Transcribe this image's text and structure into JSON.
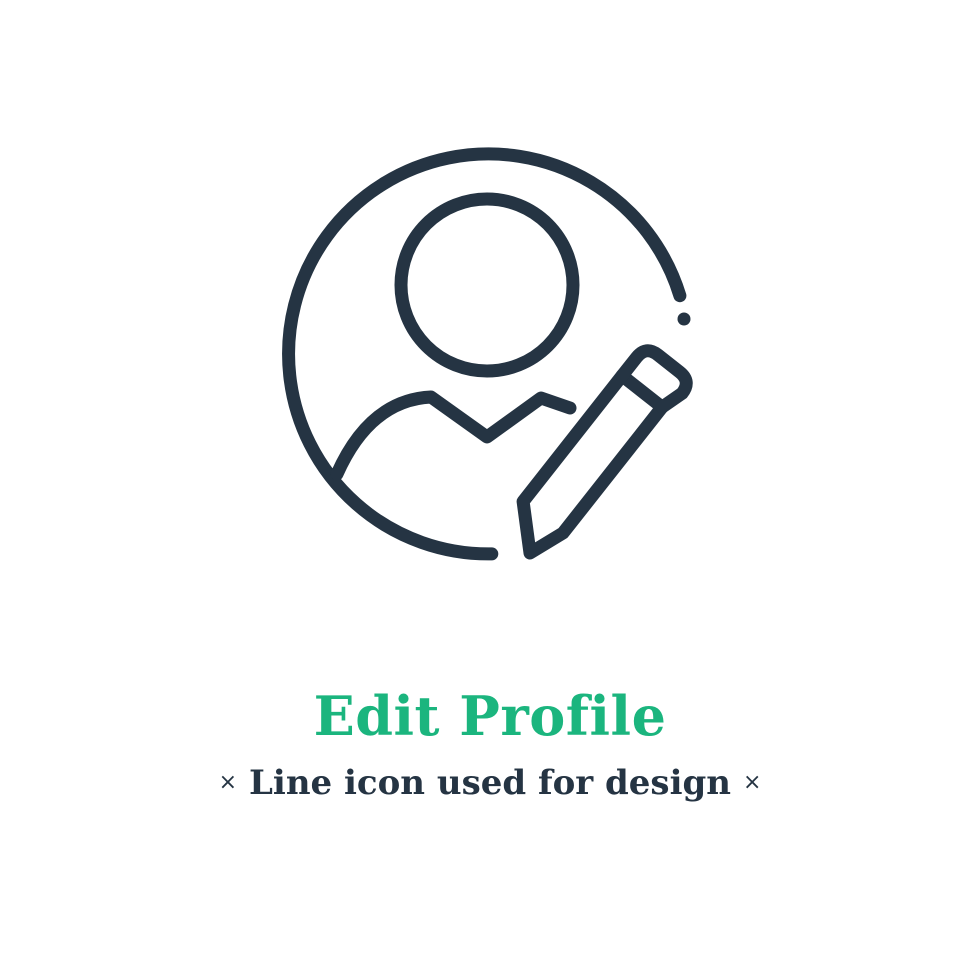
{
  "illustration": {
    "icon_name": "user-profile-edit-pencil-icon",
    "style": "line icon",
    "stroke_color": "#253443"
  },
  "caption": {
    "title": "Edit Profile",
    "title_color": "#1bb57e",
    "subtitle": "Line icon used for design",
    "separator": "×",
    "text_color": "#253443"
  }
}
